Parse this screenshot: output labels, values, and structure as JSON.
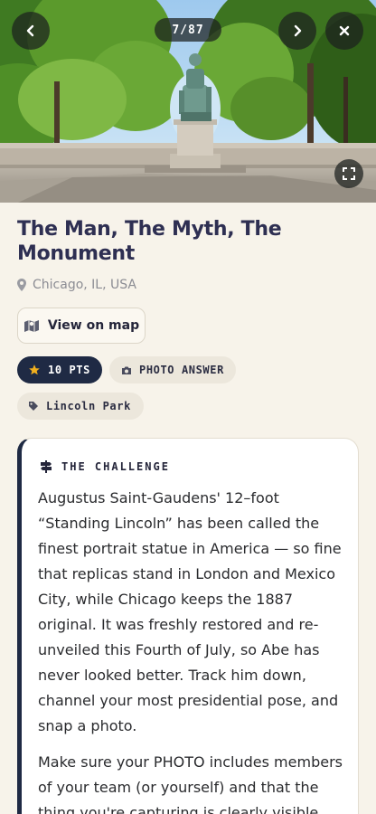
{
  "hero": {
    "counter_current": "7",
    "counter_separator": "/",
    "counter_total": "87",
    "back_icon": "chevron-left-icon",
    "next_icon": "chevron-right-icon",
    "close_icon": "close-icon",
    "expand_icon": "fullscreen-icon"
  },
  "challenge": {
    "title": "The Man, The Myth, The Monument",
    "location": "Chicago, IL, USA",
    "view_on_map_label": "View on map",
    "points_label": "10 PTS",
    "answer_type_label": "PHOTO ANSWER",
    "tag_label": "Lincoln Park"
  },
  "card": {
    "heading": "THE CHALLENGE",
    "paragraph_1": "Augustus Saint-Gaudens' 12–foot “Standing Lincoln” has been called the finest portrait statue in America — so fine that replicas stand in London and Mexico City, while Chicago keeps the 1887 original. It was freshly restored and re-unveiled this Fourth of July, so Abe has never looked better. Track him down, channel your most presidential pose, and snap a photo.",
    "paragraph_2": "Make sure your PHOTO includes members of your team (or yourself) and that the thing you're capturing is clearly visible."
  },
  "colors": {
    "background": "#f7f3ea",
    "title": "#2e2f52",
    "navy_accent": "#1f2a44",
    "star": "#f2b01e",
    "chip": "#ece7dc"
  }
}
